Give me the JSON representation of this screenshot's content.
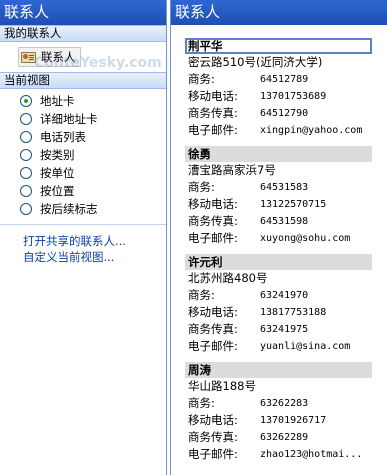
{
  "nav": {
    "title": "联系人",
    "my_contacts_header": "我的联系人",
    "folder": {
      "label": "联系人",
      "icon": "contact-card-icon"
    },
    "current_view_header": "当前视图",
    "views": [
      {
        "label": "地址卡",
        "checked": true
      },
      {
        "label": "详细地址卡",
        "checked": false
      },
      {
        "label": "电话列表",
        "checked": false
      },
      {
        "label": "按类别",
        "checked": false
      },
      {
        "label": "按单位",
        "checked": false
      },
      {
        "label": "按位置",
        "checked": false
      },
      {
        "label": "按后续标志",
        "checked": false
      }
    ],
    "links": [
      "打开共享的联系人...",
      "自定义当前视图..."
    ],
    "watermark": "ConteYesky.com"
  },
  "content": {
    "title": "联系人",
    "field_labels": {
      "business": "商务:",
      "mobile": "移动电话:",
      "fax": "商务传真:",
      "email": "电子邮件:"
    },
    "cards": [
      {
        "name": "荆平华",
        "address": "密云路510号(近同济大学)",
        "business": "64512789",
        "mobile": "13701753689",
        "fax": "64512790",
        "email": "xingpin@yahoo.com",
        "selected": true
      },
      {
        "name": "徐勇",
        "address": "漕宝路高家浜7号",
        "business": "64531583",
        "mobile": "13122570715",
        "fax": "64531598",
        "email": "xuyong@sohu.com",
        "selected": false
      },
      {
        "name": "许元利",
        "address": "北苏州路480号",
        "business": "63241970",
        "mobile": "13817753188",
        "fax": "63241975",
        "email": "yuanli@sina.com",
        "selected": false
      },
      {
        "name": "周涛",
        "address": "华山路188号",
        "business": "63262283",
        "mobile": "13701926717",
        "fax": "63262289",
        "email": "zhao123@hotmai...",
        "selected": false
      }
    ]
  },
  "colors": {
    "header_blue": "#1e4fb4",
    "link_blue": "#0b3fa8",
    "radio_checked": "#21a121",
    "card_name_bg": "#dcdcdc",
    "selection_border": "#5b82c7"
  }
}
